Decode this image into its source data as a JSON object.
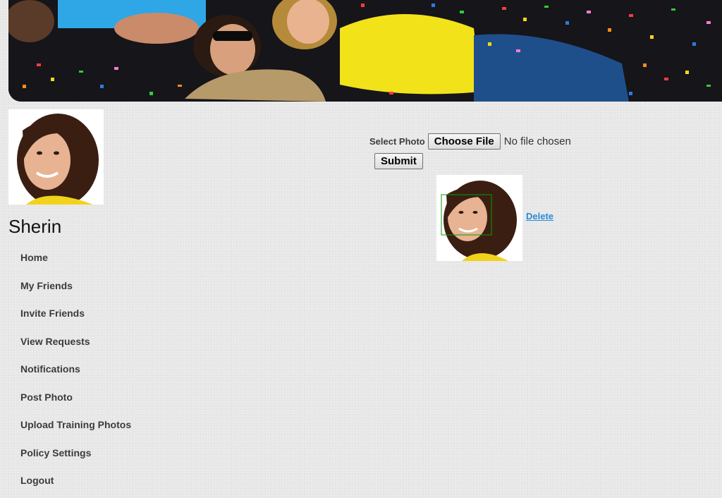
{
  "user": {
    "name": "Sherin"
  },
  "nav": {
    "items": [
      {
        "label": "Home"
      },
      {
        "label": "My Friends"
      },
      {
        "label": "Invite Friends"
      },
      {
        "label": "View Requests"
      },
      {
        "label": "Notifications"
      },
      {
        "label": "Post Photo"
      },
      {
        "label": "Upload Training Photos"
      },
      {
        "label": "Policy Settings"
      },
      {
        "label": "Logout"
      }
    ]
  },
  "upload": {
    "label": "Select Photo",
    "choose_button": "Choose File",
    "file_status": "No file chosen",
    "submit_button": "Submit"
  },
  "photos": [
    {
      "action": "Delete"
    }
  ],
  "colors": {
    "background": "#e7e7e7",
    "link": "#2a8ad6",
    "nav_text": "#3a3a3a",
    "face_box": "#00a000"
  }
}
